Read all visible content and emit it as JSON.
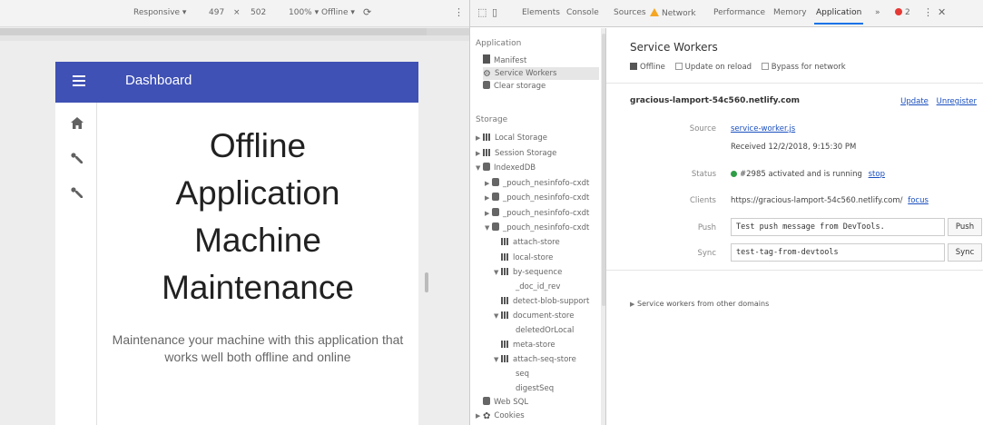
{
  "emulator": {
    "device": "Responsive ▾",
    "width": "497",
    "times": "×",
    "height": "502",
    "zoom": "100% ▾",
    "network": "Offline ▾",
    "rotate_icon": "rotate-icon",
    "more_icon": "kebab-icon"
  },
  "app": {
    "title": "Dashboard",
    "heading_lines": [
      "Offline",
      "Application",
      "Machine",
      "Maintenance"
    ],
    "subtitle": "Maintenance your machine with this application that works well both offline and online",
    "brand_color": "#3f51b5"
  },
  "devtools": {
    "tabs": [
      "Elements",
      "Console",
      "Sources",
      "Network",
      "Performance",
      "Memory",
      "Application",
      "»"
    ],
    "active_tab": "Application",
    "error_count": "2",
    "sidebar": {
      "application_header": "Application",
      "application_items": [
        "Manifest",
        "Service Workers",
        "Clear storage"
      ],
      "storage_header": "Storage",
      "storage_items": [
        "Local Storage",
        "Session Storage",
        "IndexedDB",
        "_pouch_nesinfofo-cxdt",
        "_pouch_nesinfofo-cxdt",
        "_pouch_nesinfofo-cxdt",
        "_pouch_nesinfofo-cxdt",
        "attach-store",
        "local-store",
        "by-sequence",
        "_doc_id_rev",
        "detect-blob-support",
        "document-store",
        "deletedOrLocal",
        "meta-store",
        "attach-seq-store",
        "seq",
        "digestSeq",
        "Web SQL",
        "Cookies"
      ]
    },
    "main": {
      "title": "Service Workers",
      "options": [
        "Offline",
        "Update on reload",
        "Bypass for network"
      ],
      "origin": "gracious-lamport-54c560.netlify.com",
      "update_link": "Update",
      "unregister_link": "Unregister",
      "source_label": "Source",
      "source_link": "service-worker.js",
      "received": "Received 12/2/2018, 9:15:30 PM",
      "status_label": "Status",
      "status_text": "#2985 activated and is running",
      "stop_link": "stop",
      "clients_label": "Clients",
      "clients_url": "https://gracious-lamport-54c560.netlify.com/",
      "focus_link": "focus",
      "push_label": "Push",
      "push_value": "Test push message from DevTools.",
      "push_button": "Push",
      "sync_label": "Sync",
      "sync_value": "test-tag-from-devtools",
      "sync_button": "Sync",
      "other_domains": "Service workers from other domains"
    }
  }
}
